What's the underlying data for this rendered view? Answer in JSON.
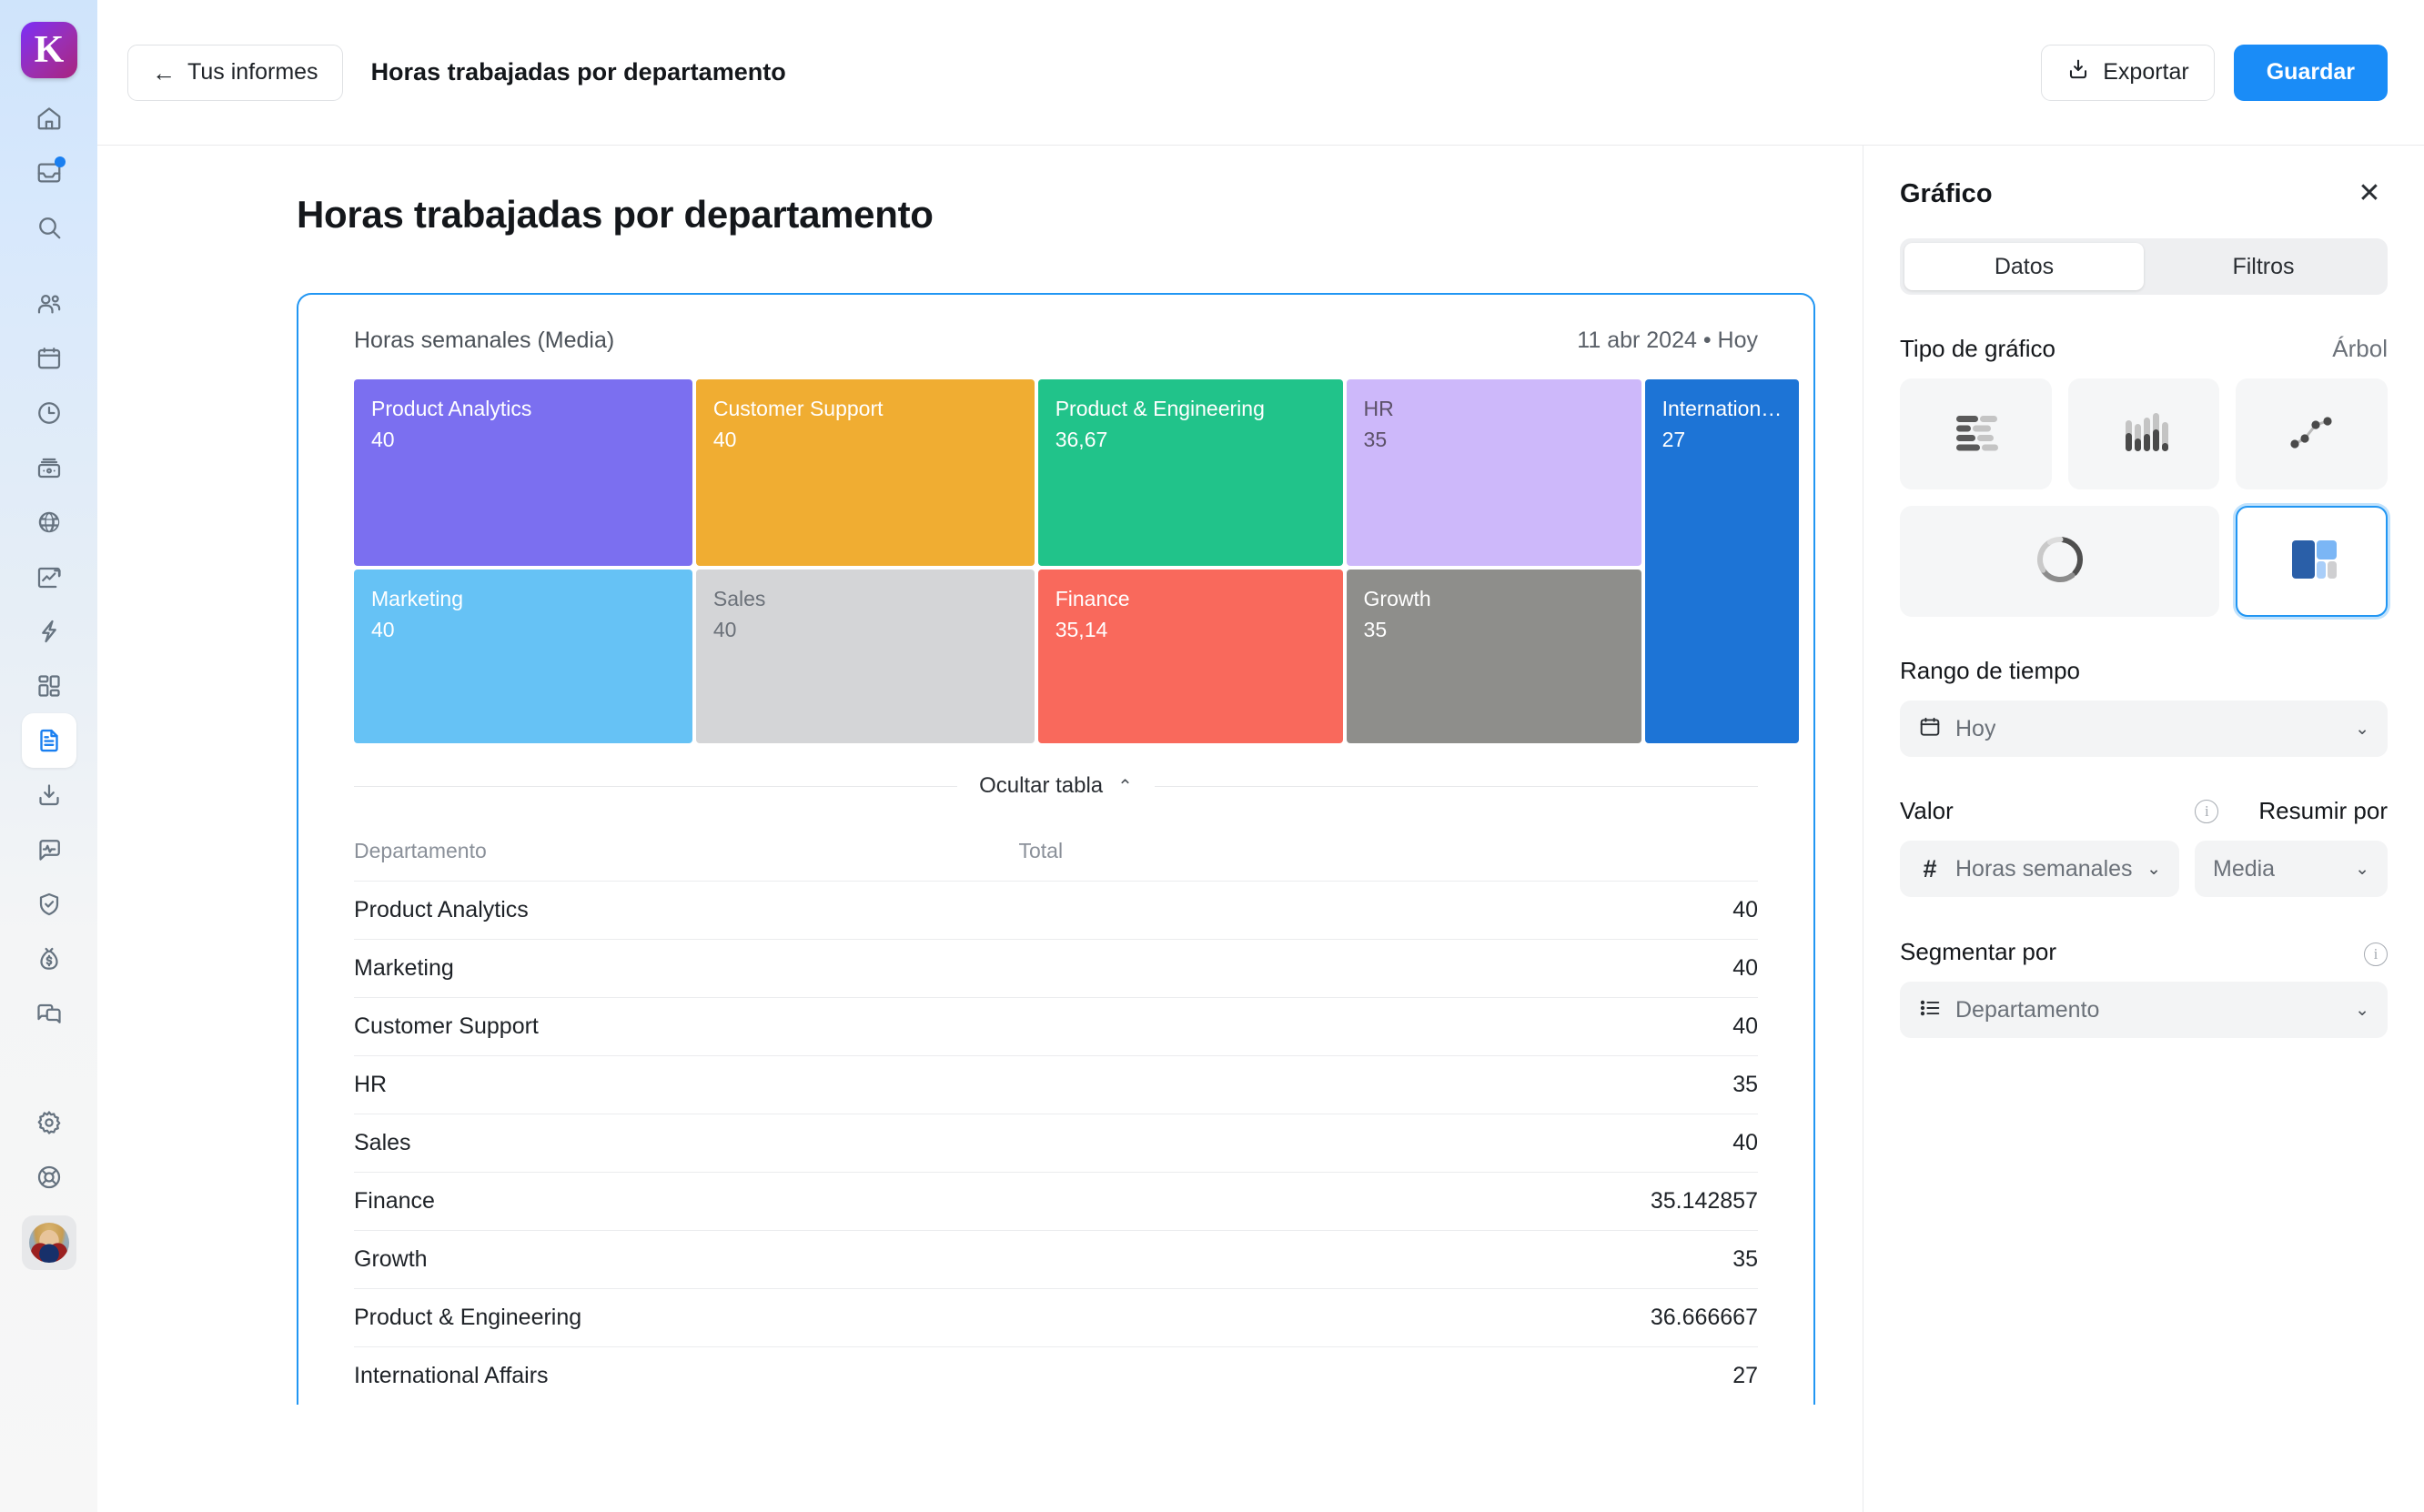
{
  "rail": {
    "logo_letter": "K",
    "items": [
      {
        "name": "home-icon",
        "label": "Inicio"
      },
      {
        "name": "inbox-icon",
        "label": "Bandeja",
        "badge": true
      },
      {
        "name": "search-icon",
        "label": "Buscar"
      },
      {
        "name": "people-icon",
        "label": "Personas"
      },
      {
        "name": "calendar-icon",
        "label": "Calendario"
      },
      {
        "name": "clock-icon",
        "label": "Tiempo"
      },
      {
        "name": "payroll-icon",
        "label": "Nómina"
      },
      {
        "name": "globe-icon",
        "label": "Global"
      },
      {
        "name": "growth-chart-icon",
        "label": "Crecimiento"
      },
      {
        "name": "lightning-icon",
        "label": "Automatizaciones"
      },
      {
        "name": "apps-grid-icon",
        "label": "Aplicaciones"
      },
      {
        "name": "document-icon",
        "label": "Informes",
        "active": true
      },
      {
        "name": "import-icon",
        "label": "Importar"
      },
      {
        "name": "pulse-chat-icon",
        "label": "Encuestas"
      },
      {
        "name": "shield-check-icon",
        "label": "Cumplimiento"
      },
      {
        "name": "money-bag-icon",
        "label": "Beneficios"
      },
      {
        "name": "chat-icon",
        "label": "Mensajes"
      }
    ],
    "bottom_items": [
      {
        "name": "gear-icon",
        "label": "Ajustes"
      },
      {
        "name": "lifebuoy-icon",
        "label": "Ayuda"
      }
    ],
    "avatar_name": "avatar"
  },
  "topbar": {
    "back_label": "Tus informes",
    "back_arrow": "←",
    "title": "Horas trabajadas por departamento",
    "export_label": "Exportar",
    "save_label": "Guardar"
  },
  "page": {
    "title": "Horas trabajadas por departamento"
  },
  "card": {
    "metric_title": "Horas semanales (Media)",
    "date_range": "11 abr 2024 • Hoy",
    "toggle_label": "Ocultar tabla",
    "toggle_chevron": "⌃"
  },
  "chart_data": {
    "type": "treemap",
    "title": "Horas semanales (Media)",
    "subtitle": "11 abr 2024 • Hoy",
    "value_label": "Horas semanales",
    "segment_label": "Departamento",
    "summarize_by": "Media",
    "decimal_separator": ",",
    "nodes": [
      {
        "label": "Product Analytics",
        "display_value": "40",
        "value": 40,
        "color": "#7b6ff0",
        "text_color": "#ffffff"
      },
      {
        "label": "Customer Support",
        "display_value": "40",
        "value": 40,
        "color": "#f0ad32",
        "text_color": "#ffffff"
      },
      {
        "label": "Product & Engineering",
        "display_value": "36,67",
        "value": 36.666667,
        "color": "#21c38a",
        "text_color": "#ffffff"
      },
      {
        "label": "HR",
        "display_value": "35",
        "value": 35,
        "color": "#cdb8fa",
        "text_color": "#5c5168"
      },
      {
        "label": "Internation…",
        "display_value": "27",
        "value": 27,
        "color": "#1d74d6",
        "text_color": "#ffffff"
      },
      {
        "label": "Marketing",
        "display_value": "40",
        "value": 40,
        "color": "#66c2f5",
        "text_color": "#ffffff"
      },
      {
        "label": "Sales",
        "display_value": "40",
        "value": 40,
        "color": "#d4d5d7",
        "text_color": "#6b7179"
      },
      {
        "label": "Finance",
        "display_value": "35,14",
        "value": 35.142857,
        "color": "#f9695c",
        "text_color": "#ffffff"
      },
      {
        "label": "Growth",
        "display_value": "35",
        "value": 35,
        "color": "#8e8e8b",
        "text_color": "#ffffff"
      }
    ]
  },
  "table": {
    "columns": [
      "Departamento",
      "Total"
    ],
    "rows": [
      {
        "name": "Product Analytics",
        "total": "40"
      },
      {
        "name": "Marketing",
        "total": "40"
      },
      {
        "name": "Customer Support",
        "total": "40"
      },
      {
        "name": "HR",
        "total": "35"
      },
      {
        "name": "Sales",
        "total": "40"
      },
      {
        "name": "Finance",
        "total": "35.142857"
      },
      {
        "name": "Growth",
        "total": "35"
      },
      {
        "name": "Product & Engineering",
        "total": "36.666667"
      },
      {
        "name": "International Affairs",
        "total": "27"
      }
    ]
  },
  "panel": {
    "title": "Gráfico",
    "close_glyph": "✕",
    "tabs": [
      {
        "label": "Datos",
        "active": true
      },
      {
        "label": "Filtros",
        "active": false
      }
    ],
    "chart_type_label": "Tipo de gráfico",
    "chart_type_value": "Árbol",
    "chart_types": [
      {
        "name": "bar-horizontal-chart-icon",
        "selected": false
      },
      {
        "name": "column-chart-icon",
        "selected": false
      },
      {
        "name": "line-chart-icon",
        "selected": false
      },
      {
        "name": "donut-chart-icon",
        "selected": false
      },
      {
        "name": "treemap-chart-icon",
        "selected": true
      }
    ],
    "time_range_label": "Rango de tiempo",
    "time_range_value": "Hoy",
    "value_label": "Valor",
    "value_field": "Horas semanales",
    "value_prefix": "#",
    "summarize_label": "Resumir por",
    "summarize_value": "Media",
    "segment_label": "Segmentar por",
    "segment_value": "Departamento",
    "chevron": "⌄"
  },
  "colors": {
    "accent": "#1a8cf7",
    "selected_border": "#2196f3",
    "card_border": "#2196f3"
  }
}
